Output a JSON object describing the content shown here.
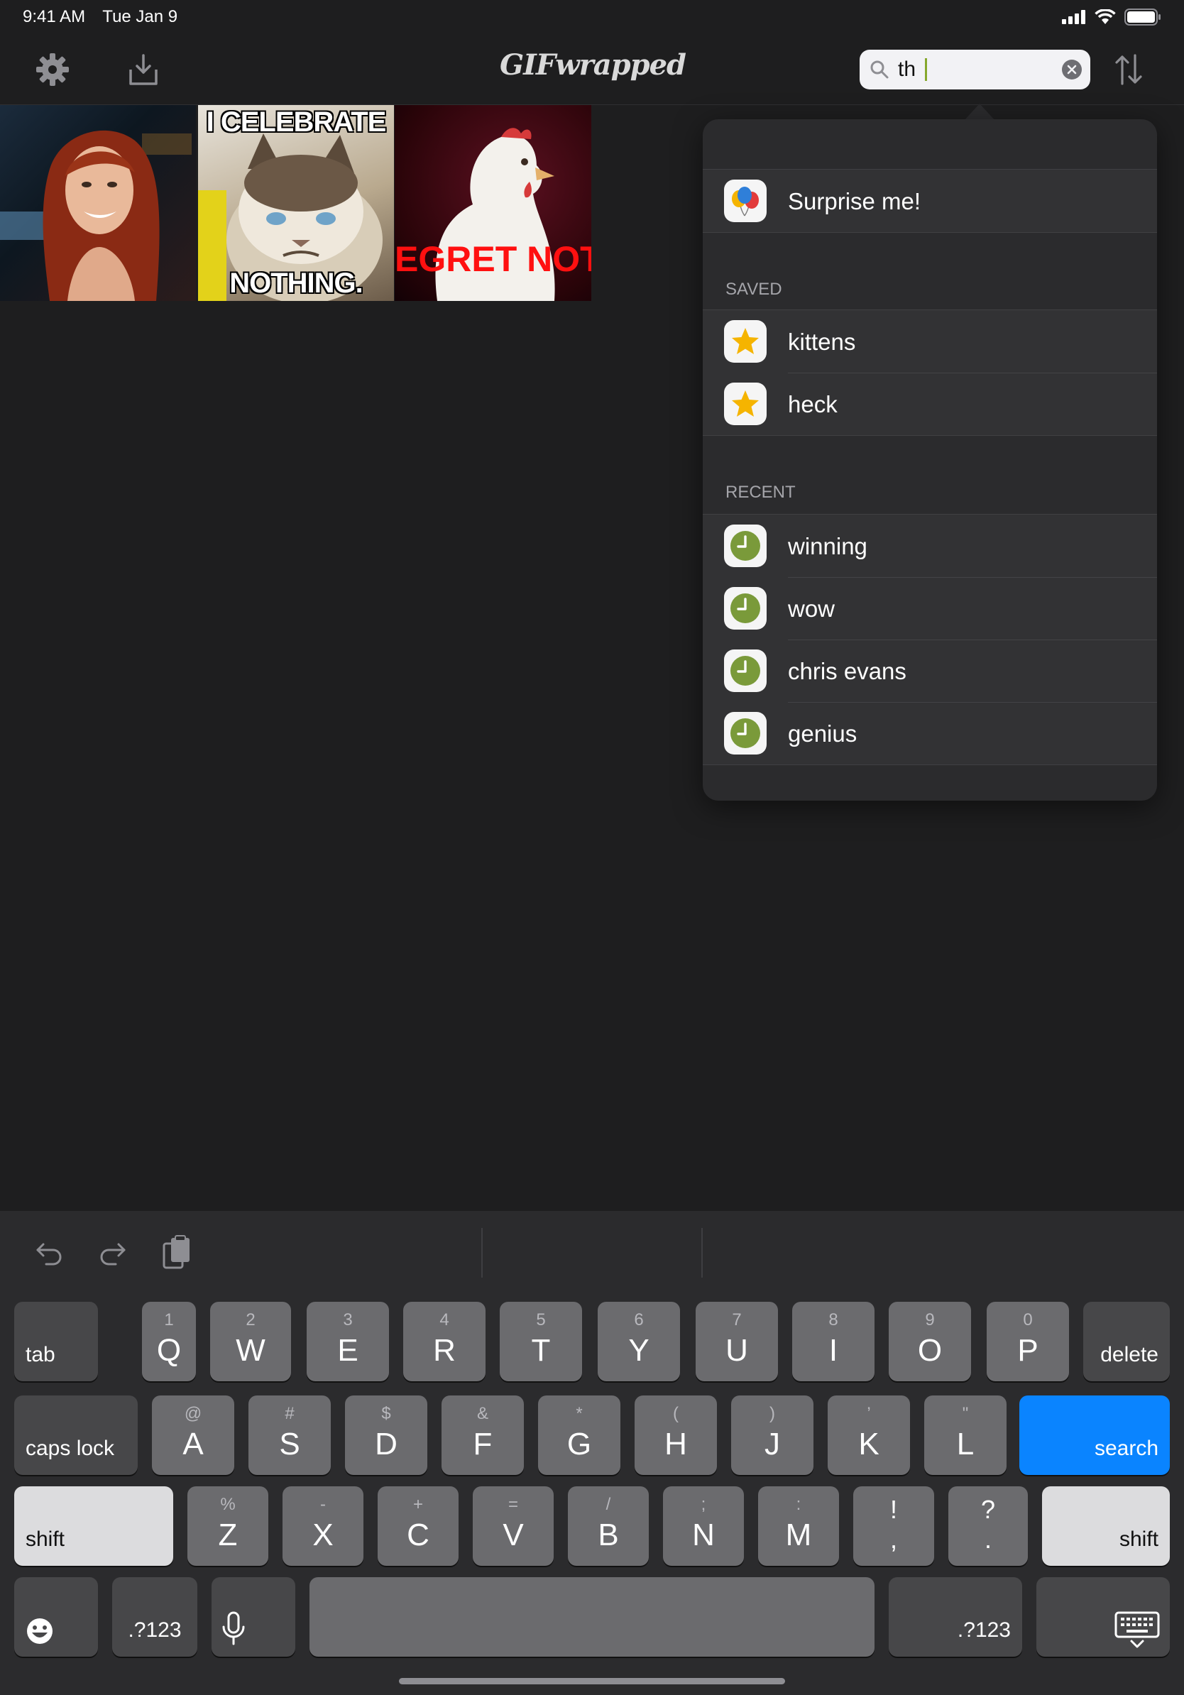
{
  "status_bar": {
    "time": "9:41 AM",
    "date": "Tue Jan 9"
  },
  "toolbar": {
    "app_title": "GIFwrapped",
    "search": {
      "value": "th",
      "placeholder": ""
    }
  },
  "gifs": [
    {
      "id": "gif-1",
      "top_text": "",
      "bottom_text": ""
    },
    {
      "id": "gif-2",
      "top_text": "I CELEBRATE",
      "bottom_text": "NOTHING."
    },
    {
      "id": "gif-3",
      "overlay_text": "EGRET NOTH"
    }
  ],
  "suggestions": {
    "surprise": {
      "label": "Surprise me!"
    },
    "saved_header": "SAVED",
    "saved": [
      {
        "label": "kittens"
      },
      {
        "label": "heck"
      }
    ],
    "recent_header": "RECENT",
    "recent": [
      {
        "label": "winning"
      },
      {
        "label": "wow"
      },
      {
        "label": "chris evans"
      },
      {
        "label": "genius"
      }
    ]
  },
  "keyboard": {
    "row1": {
      "tab": "tab",
      "keys": [
        {
          "main": "Q",
          "hint": "1"
        },
        {
          "main": "W",
          "hint": "2"
        },
        {
          "main": "E",
          "hint": "3"
        },
        {
          "main": "R",
          "hint": "4"
        },
        {
          "main": "T",
          "hint": "5"
        },
        {
          "main": "Y",
          "hint": "6"
        },
        {
          "main": "U",
          "hint": "7"
        },
        {
          "main": "I",
          "hint": "8"
        },
        {
          "main": "O",
          "hint": "9"
        },
        {
          "main": "P",
          "hint": "0"
        }
      ],
      "delete": "delete"
    },
    "row2": {
      "caps": "caps lock",
      "keys": [
        {
          "main": "A",
          "hint": "@"
        },
        {
          "main": "S",
          "hint": "#"
        },
        {
          "main": "D",
          "hint": "$"
        },
        {
          "main": "F",
          "hint": "&"
        },
        {
          "main": "G",
          "hint": "*"
        },
        {
          "main": "H",
          "hint": "("
        },
        {
          "main": "J",
          "hint": ")"
        },
        {
          "main": "K",
          "hint": "’"
        },
        {
          "main": "L",
          "hint": "\""
        }
      ],
      "search": "search"
    },
    "row3": {
      "shift_left": "shift",
      "keys": [
        {
          "main": "Z",
          "hint": "%"
        },
        {
          "main": "X",
          "hint": "-"
        },
        {
          "main": "C",
          "hint": "+"
        },
        {
          "main": "V",
          "hint": "="
        },
        {
          "main": "B",
          "hint": "/"
        },
        {
          "main": "N",
          "hint": ";"
        },
        {
          "main": "M",
          "hint": ":"
        }
      ],
      "punct": [
        {
          "top": "!",
          "bottom": ","
        },
        {
          "top": "?",
          "bottom": "."
        }
      ],
      "shift_right": "shift"
    },
    "row4": {
      "numbers_left": ".?123",
      "numbers_right": ".?123"
    }
  },
  "colors": {
    "accent": "#0a84ff",
    "cursor": "#86a82c",
    "recent_icon": "#7a9a3a",
    "star": "#f5b400"
  }
}
